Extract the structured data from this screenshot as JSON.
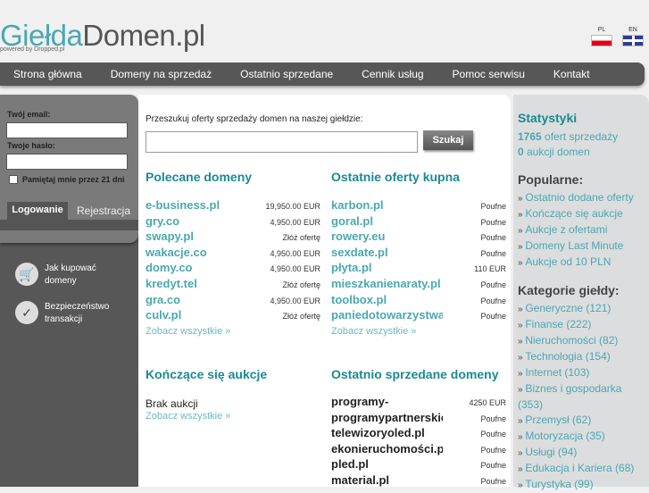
{
  "logo": {
    "part1": "Giełda",
    "part2": "Domen.pl",
    "powered": "powered by Dropped.pl"
  },
  "lang": {
    "pl": "PL",
    "en": "EN"
  },
  "nav": [
    "Strona główna",
    "Domeny na sprzedaż",
    "Ostatnio sprzedane",
    "Cennik usług",
    "Pomoc serwisu",
    "Kontakt"
  ],
  "login": {
    "email_label": "Twój email:",
    "password_label": "Twoje hasło:",
    "remember": "Pamiętaj mnie przez 21 dni",
    "tab_login": "Logowanie",
    "tab_register": "Rejestracja"
  },
  "help": [
    {
      "label": "Jak kupować domeny"
    },
    {
      "label": "Bezpieczeństwo transakcji"
    }
  ],
  "search": {
    "label": "Przeszukuj oferty sprzedaży domen na naszej giełdzie:",
    "button": "Szukaj"
  },
  "featured": {
    "title": "Polecane domeny",
    "more": "Zobacz wszystkie »",
    "items": [
      {
        "d": "e-business.pl",
        "p": "19,950.00 EUR"
      },
      {
        "d": "gry.co",
        "p": "4,950.00 EUR"
      },
      {
        "d": "swapy.pl",
        "p": "Złóż ofertę"
      },
      {
        "d": "wakacje.co",
        "p": "4,950.00 EUR"
      },
      {
        "d": "domy.co",
        "p": "4,950.00 EUR"
      },
      {
        "d": "kredyt.tel",
        "p": "Złóż ofertę"
      },
      {
        "d": "gra.co",
        "p": "4,950.00 EUR"
      },
      {
        "d": "culv.pl",
        "p": "Złóż ofertę"
      }
    ]
  },
  "buy": {
    "title": "Ostatnie oferty kupna",
    "more": "Zobacz wszystkie »",
    "items": [
      {
        "d": "karbon.pl",
        "p": "Poufne"
      },
      {
        "d": "goral.pl",
        "p": "Poufne"
      },
      {
        "d": "rowery.eu",
        "p": "Poufne"
      },
      {
        "d": "sexdate.pl",
        "p": "Poufne"
      },
      {
        "d": "płyta.pl",
        "p": "110 EUR"
      },
      {
        "d": "mieszkanienaraty.pl",
        "p": "Poufne"
      },
      {
        "d": "toolbox.pl",
        "p": "Poufne"
      },
      {
        "d": "paniedotowarzystwa.",
        "p": "Poufne"
      }
    ]
  },
  "auctions": {
    "title": "Kończące się aukcje",
    "empty": "Brak aukcji",
    "more": "Zobacz wszystkie »"
  },
  "sold": {
    "title": "Ostatnio sprzedane domeny",
    "items": [
      {
        "d": "programy-",
        "p": "4250 EUR"
      },
      {
        "d": "programypartnerskie.",
        "p": "Poufne"
      },
      {
        "d": "telewizoryoled.pl",
        "p": "Poufne"
      },
      {
        "d": "ekonieruchomości.pl",
        "p": "Poufne"
      },
      {
        "d": "pled.pl",
        "p": "Poufne"
      },
      {
        "d": "material.pl",
        "p": "Poufne"
      }
    ]
  },
  "stats": {
    "title": "Statystyki",
    "offers_n": "1765",
    "offers": "ofert sprzedaży",
    "auctions_n": "0",
    "auctions": "aukcji domen"
  },
  "popular": {
    "title": "Popularne:",
    "items": [
      "Ostatnio dodane oferty",
      "Kończące się aukcje",
      "Aukcje z ofertami",
      "Domeny Last Minute",
      "Aukcje od 10 PLN"
    ]
  },
  "categories": {
    "title": "Kategorie giełdy:",
    "items": [
      "Generyczne (121)",
      "Finanse (222)",
      "Nieruchomości (82)",
      "Technologia (154)",
      "Internet (103)",
      "Biznes i gospodarka (353)",
      "Przemysł (62)",
      "Motoryzacja (35)",
      "Usługi (94)",
      "Edukacja i Kariera (68)",
      "Turystyka (99)"
    ]
  }
}
